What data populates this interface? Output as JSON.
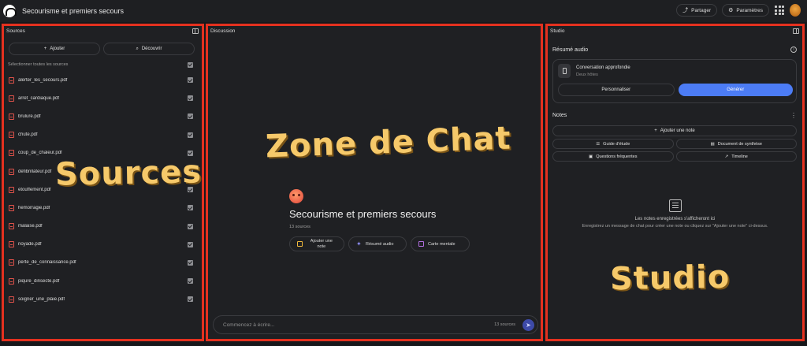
{
  "app": {
    "title": "Secourisme et premiers secours"
  },
  "header": {
    "share_label": "Partager",
    "settings_label": "Paramètres"
  },
  "sources_panel": {
    "title": "Sources",
    "add_label": "Ajouter",
    "discover_label": "Découvrir",
    "select_all_label": "Sélectionner toutes les sources",
    "items": [
      "alerter_les_secours.pdf",
      "arret_cardiaque.pdf",
      "brulure.pdf",
      "chute.pdf",
      "coup_de_chaleur.pdf",
      "defibrillateur.pdf",
      "etouffement.pdf",
      "hemorragie.pdf",
      "malaise.pdf",
      "noyade.pdf",
      "perte_de_connaissance.pdf",
      "piqure_dinsecte.pdf",
      "soigner_une_plaie.pdf"
    ]
  },
  "discussion_panel": {
    "title": "Discussion",
    "notebook_title": "Secourisme et premiers secours",
    "source_count": "13 sources",
    "actions": [
      "Ajouter une note",
      "Résumé audio",
      "Carte mentale"
    ],
    "chat_placeholder": "Commencez à écrire...",
    "chat_source_count": "13 sources"
  },
  "studio_panel": {
    "title": "Studio",
    "audio_title": "Résumé audio",
    "conversation_title": "Conversation approfondie",
    "conversation_sub": "Deux hôtes",
    "customize_label": "Personnaliser",
    "generate_label": "Générer",
    "notes_title": "Notes",
    "add_note_label": "Ajouter une note",
    "note_buttons": [
      "Guide d'étude",
      "Document de synthèse",
      "Questions fréquentes",
      "Timeline"
    ],
    "empty_title": "Les notes enregistrées s'afficheront ici",
    "empty_sub": "Enregistrez un message de chat pour créer une note ou cliquez sur \"Ajouter une note\" ci-dessus."
  },
  "overlays": {
    "sources": "Sources",
    "chat": "Zone de Chat",
    "studio": "Studio"
  },
  "colors": {
    "highlight_border": "#e5311f",
    "accent": "#4c7cf5",
    "overlay_text": "#f6c96a"
  }
}
